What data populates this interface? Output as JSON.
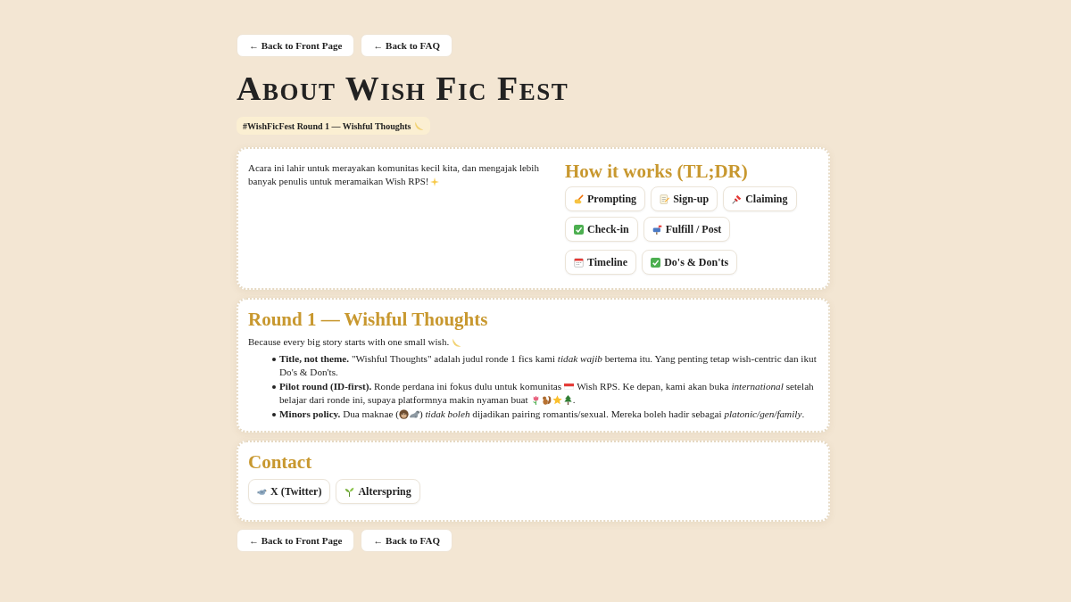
{
  "nav_top": [
    "← Back to Front Page",
    "← Back to FAQ"
  ],
  "title": "About Wish Fic Fest",
  "tag": "#WishFicFest Round 1 — Wishful Thoughts",
  "intro_card": {
    "text_lines": [
      "Acara ini lahir untuk merayakan komunitas kecil kita, dan mengajak lebih",
      "banyak penulis untuk meramaikan Wish RPS!"
    ],
    "how_it_works": {
      "heading": "How it works (TL;DR)",
      "chip_rows": [
        [
          "Prompting",
          "Sign-up",
          "Claiming"
        ],
        [
          "Check-in",
          "Fulfill / Post"
        ],
        [
          "Timeline",
          "Do's & Don'ts"
        ]
      ]
    }
  },
  "round_card": {
    "heading": "Round 1 — Wishful Thoughts",
    "subtitle": "Because every big story starts with one small wish.",
    "bullets": [
      {
        "lines": [
          [
            "**Title, not theme.** \"Wishful Thoughts\" adalah judul ronde 1 fics kami *tidak wajib* bertema itu. Yang penting tetap wish-centric dan ikut Do's & Don'ts."
          ]
        ]
      },
      {
        "lines": [
          [
            "**Pilot round (ID-first).** Ronde perdana ini fokus dulu untuk komunitas",
            "Wish RPS. Ke depan, kami akan buka *international* setelah"
          ],
          [
            "belajar dari ronde ini, supaya platformnya makin nyaman buat",
            "."
          ]
        ]
      },
      {
        "lines": [
          [
            "**Minors policy.** Dua maknae (",
            ") *tidak boleh* dijadikan pairing romantis/sexual. Mereka boleh hadir sebagai *platonic/gen/family*."
          ]
        ]
      }
    ]
  },
  "contact_card": {
    "heading": "Contact",
    "links": [
      "X (Twitter)",
      "Alterspring"
    ]
  },
  "nav_bottom": [
    "← Back to Front Page",
    "← Back to FAQ"
  ]
}
